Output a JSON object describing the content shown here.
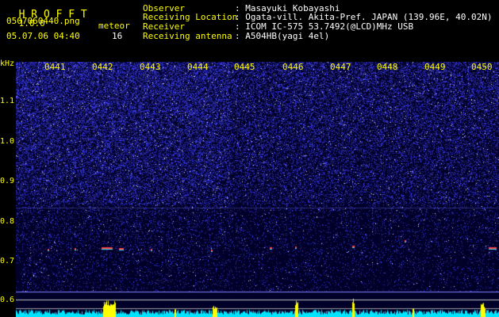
{
  "header": {
    "brand": "H R O F F T",
    "version": "1.0.0",
    "filename": "0507060440.png",
    "timestamp": "05.07.06 04:40",
    "meteor_label": "meteor",
    "meteor_count": "16",
    "fields": [
      {
        "label": "Observer",
        "value": ": Masayuki Kobayashi"
      },
      {
        "label": "Receiving Location",
        "value": ": Ogata-vill. Akita-Pref. JAPAN (139.96E, 40.02N)"
      },
      {
        "label": "Receiver",
        "value": ": ICOM IC-575 53.7492(@LCD)MHz USB"
      },
      {
        "label": "Receiving antenna",
        "value": ": A504HB(yagi 4el)"
      }
    ]
  },
  "axis": {
    "unit": "kHz",
    "ticks": [
      "1.1",
      "1.0",
      "0.9",
      "0.8",
      "0.7",
      "0.6"
    ]
  },
  "time_labels": [
    "0441",
    "0442",
    "0443",
    "0444",
    "0445",
    "0446",
    "0447",
    "0448",
    "0449",
    "0450"
  ],
  "colors": {
    "label": "#ffff00",
    "value": "#ffffff",
    "meteor": "#40ff40",
    "spectrum_bg": "#000030",
    "noise": "#2a2ae6",
    "level": "#00e5ff",
    "peak": "#ffff00"
  }
}
